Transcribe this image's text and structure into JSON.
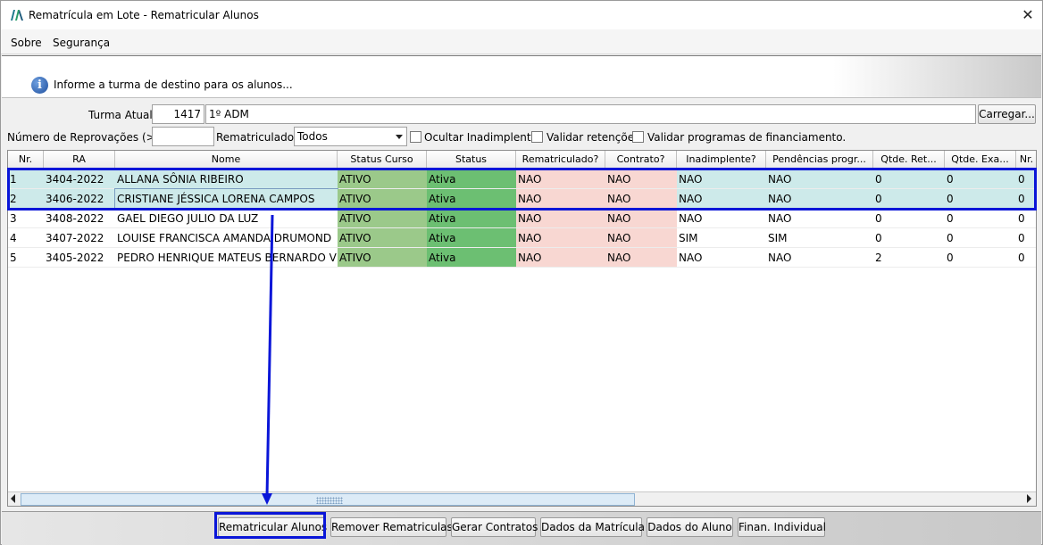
{
  "window": {
    "title": "Rematrícula em Lote - Rematricular Alunos",
    "close_symbol": "✕"
  },
  "menu": {
    "items": [
      "Sobre",
      "Segurança"
    ]
  },
  "banner": {
    "message": "Informe a turma de destino para os alunos..."
  },
  "form": {
    "turma_label": "Turma Atual:",
    "turma_code": "1417",
    "turma_name": "1º ADM",
    "carregar_button": "Carregar...",
    "reprovacoes_label": "Número de Reprovações (>=):",
    "reprovacoes_value": "",
    "rematriculados_label": "Rematriculados:",
    "rematriculados_value": "Todos",
    "ocultar_label": "Ocultar Inadimplentes",
    "retencoes_label": "Validar retenções.",
    "financiamento_label": "Validar programas de financiamento."
  },
  "table": {
    "columns": [
      "Nr.",
      "RA",
      "Nome",
      "Status Curso",
      "Status",
      "Rematriculado?",
      "Contrato?",
      "Inadimplente?",
      "Pendências progr...",
      "Qtde. Ret...",
      "Qtde. Exa...",
      "Nr."
    ],
    "rows": [
      [
        "1",
        "3404-2022",
        "ALLANA SÔNIA RIBEIRO",
        "ATIVO",
        "Ativa",
        "NAO",
        "NAO",
        "NAO",
        "NAO",
        "0",
        "0",
        "0"
      ],
      [
        "2",
        "3406-2022",
        "CRISTIANE JÉSSICA LORENA CAMPOS",
        "ATIVO",
        "Ativa",
        "NAO",
        "NAO",
        "NAO",
        "NAO",
        "0",
        "0",
        "0"
      ],
      [
        "3",
        "3408-2022",
        "GAEL DIEGO JULIO DA LUZ",
        "ATIVO",
        "Ativa",
        "NAO",
        "NAO",
        "NAO",
        "NAO",
        "0",
        "0",
        "0"
      ],
      [
        "4",
        "3407-2022",
        "LOUISE FRANCISCA AMANDA DRUMOND",
        "ATIVO",
        "Ativa",
        "NAO",
        "NAO",
        "SIM",
        "SIM",
        "0",
        "0",
        "0"
      ],
      [
        "5",
        "3405-2022",
        "PEDRO HENRIQUE MATEUS BERNARDO VIA...",
        "ATIVO",
        "Ativa",
        "NAO",
        "NAO",
        "NAO",
        "NAO",
        "2",
        "0",
        "0"
      ]
    ]
  },
  "buttons": [
    "Rematricular Alunos",
    "Remover Rematriculas",
    "Gerar Contratos",
    "Dados da Matrícula",
    "Dados do Aluno",
    "Finan. Individual"
  ],
  "colors": {
    "status_curso": "#9bc98a",
    "status": "#6cbf72",
    "negative": "#f8d7d2",
    "selected": "#cdeaea",
    "highlight": "#0a16d8"
  }
}
